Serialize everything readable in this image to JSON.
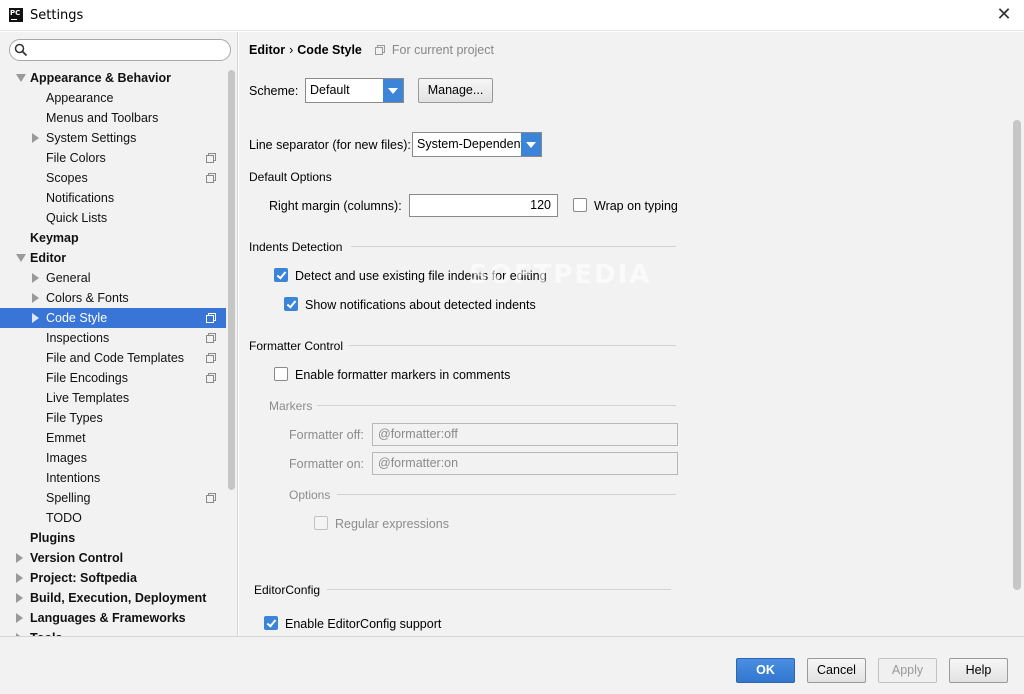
{
  "window": {
    "title": "Settings",
    "app_icon": "PC"
  },
  "search": {
    "value": "",
    "placeholder": ""
  },
  "tree": [
    {
      "label": "Appearance & Behavior",
      "level": 0,
      "bold": true,
      "expanded": true
    },
    {
      "label": "Appearance",
      "level": 1
    },
    {
      "label": "Menus and Toolbars",
      "level": 1
    },
    {
      "label": "System Settings",
      "level": 1,
      "collapsed": true
    },
    {
      "label": "File Colors",
      "level": 1,
      "project": true
    },
    {
      "label": "Scopes",
      "level": 1,
      "project": true
    },
    {
      "label": "Notifications",
      "level": 1
    },
    {
      "label": "Quick Lists",
      "level": 1
    },
    {
      "label": "Keymap",
      "level": 0,
      "bold": true
    },
    {
      "label": "Editor",
      "level": 0,
      "bold": true,
      "expanded": true
    },
    {
      "label": "General",
      "level": 1,
      "collapsed": true
    },
    {
      "label": "Colors & Fonts",
      "level": 1,
      "collapsed": true
    },
    {
      "label": "Code Style",
      "level": 1,
      "collapsed": true,
      "project": true,
      "selected": true
    },
    {
      "label": "Inspections",
      "level": 1,
      "project": true
    },
    {
      "label": "File and Code Templates",
      "level": 1,
      "project": true
    },
    {
      "label": "File Encodings",
      "level": 1,
      "project": true
    },
    {
      "label": "Live Templates",
      "level": 1
    },
    {
      "label": "File Types",
      "level": 1
    },
    {
      "label": "Emmet",
      "level": 1
    },
    {
      "label": "Images",
      "level": 1
    },
    {
      "label": "Intentions",
      "level": 1
    },
    {
      "label": "Spelling",
      "level": 1,
      "project": true
    },
    {
      "label": "TODO",
      "level": 1
    },
    {
      "label": "Plugins",
      "level": 0,
      "bold": true
    },
    {
      "label": "Version Control",
      "level": 0,
      "bold": true,
      "collapsed": true
    },
    {
      "label": "Project: Softpedia",
      "level": 0,
      "bold": true,
      "collapsed": true
    },
    {
      "label": "Build, Execution, Deployment",
      "level": 0,
      "bold": true,
      "collapsed": true
    },
    {
      "label": "Languages & Frameworks",
      "level": 0,
      "bold": true,
      "collapsed": true
    },
    {
      "label": "Tools",
      "level": 0,
      "bold": true,
      "collapsed": true
    }
  ],
  "breadcrumb": {
    "part1": "Editor",
    "separator": "›",
    "part2": "Code Style",
    "note": "For current project"
  },
  "scheme": {
    "label": "Scheme:",
    "value": "Default",
    "manage_label": "Manage..."
  },
  "line_separator": {
    "label": "Line separator (for new files):",
    "value": "System-Dependent"
  },
  "default_options": {
    "title": "Default Options",
    "right_margin_label": "Right margin (columns):",
    "right_margin_value": "120",
    "wrap_on_typing_label": "Wrap on typing",
    "wrap_on_typing_checked": false
  },
  "indents_detection": {
    "title": "Indents Detection",
    "detect_label": "Detect and use existing file indents for editing",
    "detect_checked": true,
    "notify_label": "Show notifications about detected indents",
    "notify_checked": true
  },
  "formatter_control": {
    "title": "Formatter Control",
    "enable_label": "Enable formatter markers in comments",
    "enable_checked": false,
    "markers_title": "Markers",
    "off_label": "Formatter off:",
    "off_value": "@formatter:off",
    "on_label": "Formatter on:",
    "on_value": "@formatter:on",
    "options_title": "Options",
    "regex_label": "Regular expressions",
    "regex_checked": false
  },
  "editorconfig": {
    "title": "EditorConfig",
    "enable_label": "Enable EditorConfig support",
    "enable_checked": true
  },
  "watermark": "SOFTPEDIA",
  "buttons": {
    "ok": "OK",
    "cancel": "Cancel",
    "apply": "Apply",
    "help": "Help"
  },
  "colors": {
    "accent": "#3875d7",
    "checkbox": "#3b84d8",
    "panel": "#f2f2f2"
  }
}
